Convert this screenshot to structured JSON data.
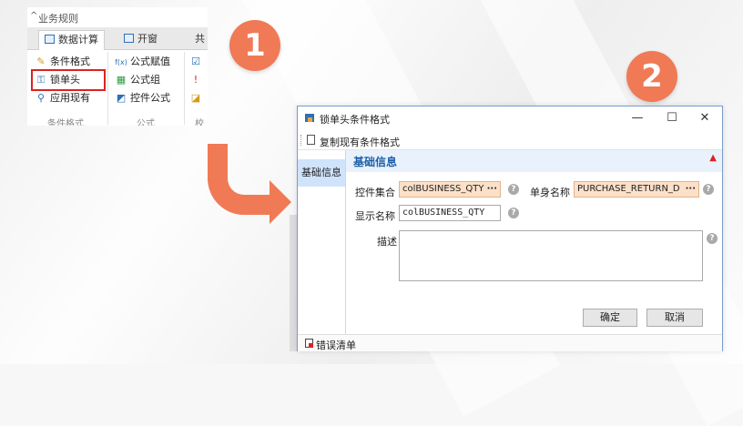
{
  "ribbon": {
    "group_title": "业务规则",
    "tabs": [
      {
        "label": "数据计算"
      },
      {
        "label": "开窗"
      },
      {
        "label": "共"
      }
    ],
    "col1": [
      "条件格式",
      "锁单头",
      "应用现有"
    ],
    "col2": [
      "公式赋值",
      "公式组",
      "控件公式"
    ],
    "groups": [
      "条件格式",
      "公式",
      "校"
    ]
  },
  "badges": [
    "1",
    "2"
  ],
  "dialog": {
    "title": "锁单头条件格式",
    "toolbar_label": "复制现有条件格式",
    "side_item": "基础信息",
    "section_title": "基础信息",
    "fields": {
      "control_set_label": "控件集合",
      "control_set_value": "colBUSINESS_QTY",
      "doc_name_label": "单身名称",
      "doc_name_value": "PURCHASE_RETURN_D",
      "display_name_label": "显示名称",
      "display_name_value": "colBUSINESS_QTY",
      "description_label": "描述"
    },
    "buttons": {
      "ok": "确定",
      "cancel": "取消"
    },
    "status_label": "错误清单",
    "window_controls": {
      "minimize": "—",
      "maximize": "☐",
      "close": "✕"
    }
  },
  "colors": {
    "accent": "#f07a55",
    "highlight": "#dd2222",
    "link_blue": "#1d5fa8"
  }
}
